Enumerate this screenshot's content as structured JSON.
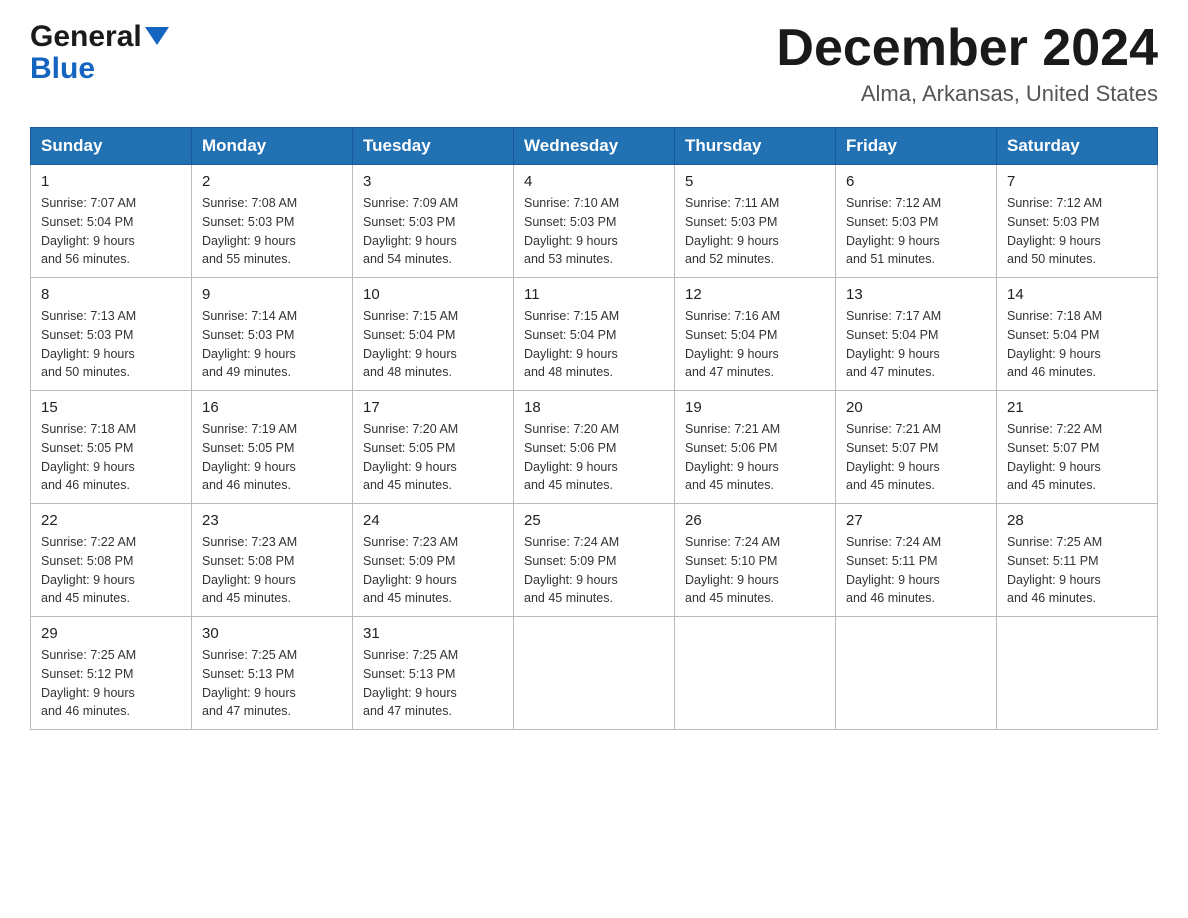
{
  "header": {
    "logo_general": "General",
    "logo_blue": "Blue",
    "month_year": "December 2024",
    "location": "Alma, Arkansas, United States"
  },
  "days_of_week": [
    "Sunday",
    "Monday",
    "Tuesday",
    "Wednesday",
    "Thursday",
    "Friday",
    "Saturday"
  ],
  "weeks": [
    [
      {
        "day": "1",
        "sunrise": "7:07 AM",
        "sunset": "5:04 PM",
        "daylight": "9 hours and 56 minutes."
      },
      {
        "day": "2",
        "sunrise": "7:08 AM",
        "sunset": "5:03 PM",
        "daylight": "9 hours and 55 minutes."
      },
      {
        "day": "3",
        "sunrise": "7:09 AM",
        "sunset": "5:03 PM",
        "daylight": "9 hours and 54 minutes."
      },
      {
        "day": "4",
        "sunrise": "7:10 AM",
        "sunset": "5:03 PM",
        "daylight": "9 hours and 53 minutes."
      },
      {
        "day": "5",
        "sunrise": "7:11 AM",
        "sunset": "5:03 PM",
        "daylight": "9 hours and 52 minutes."
      },
      {
        "day": "6",
        "sunrise": "7:12 AM",
        "sunset": "5:03 PM",
        "daylight": "9 hours and 51 minutes."
      },
      {
        "day": "7",
        "sunrise": "7:12 AM",
        "sunset": "5:03 PM",
        "daylight": "9 hours and 50 minutes."
      }
    ],
    [
      {
        "day": "8",
        "sunrise": "7:13 AM",
        "sunset": "5:03 PM",
        "daylight": "9 hours and 50 minutes."
      },
      {
        "day": "9",
        "sunrise": "7:14 AM",
        "sunset": "5:03 PM",
        "daylight": "9 hours and 49 minutes."
      },
      {
        "day": "10",
        "sunrise": "7:15 AM",
        "sunset": "5:04 PM",
        "daylight": "9 hours and 48 minutes."
      },
      {
        "day": "11",
        "sunrise": "7:15 AM",
        "sunset": "5:04 PM",
        "daylight": "9 hours and 48 minutes."
      },
      {
        "day": "12",
        "sunrise": "7:16 AM",
        "sunset": "5:04 PM",
        "daylight": "9 hours and 47 minutes."
      },
      {
        "day": "13",
        "sunrise": "7:17 AM",
        "sunset": "5:04 PM",
        "daylight": "9 hours and 47 minutes."
      },
      {
        "day": "14",
        "sunrise": "7:18 AM",
        "sunset": "5:04 PM",
        "daylight": "9 hours and 46 minutes."
      }
    ],
    [
      {
        "day": "15",
        "sunrise": "7:18 AM",
        "sunset": "5:05 PM",
        "daylight": "9 hours and 46 minutes."
      },
      {
        "day": "16",
        "sunrise": "7:19 AM",
        "sunset": "5:05 PM",
        "daylight": "9 hours and 46 minutes."
      },
      {
        "day": "17",
        "sunrise": "7:20 AM",
        "sunset": "5:05 PM",
        "daylight": "9 hours and 45 minutes."
      },
      {
        "day": "18",
        "sunrise": "7:20 AM",
        "sunset": "5:06 PM",
        "daylight": "9 hours and 45 minutes."
      },
      {
        "day": "19",
        "sunrise": "7:21 AM",
        "sunset": "5:06 PM",
        "daylight": "9 hours and 45 minutes."
      },
      {
        "day": "20",
        "sunrise": "7:21 AM",
        "sunset": "5:07 PM",
        "daylight": "9 hours and 45 minutes."
      },
      {
        "day": "21",
        "sunrise": "7:22 AM",
        "sunset": "5:07 PM",
        "daylight": "9 hours and 45 minutes."
      }
    ],
    [
      {
        "day": "22",
        "sunrise": "7:22 AM",
        "sunset": "5:08 PM",
        "daylight": "9 hours and 45 minutes."
      },
      {
        "day": "23",
        "sunrise": "7:23 AM",
        "sunset": "5:08 PM",
        "daylight": "9 hours and 45 minutes."
      },
      {
        "day": "24",
        "sunrise": "7:23 AM",
        "sunset": "5:09 PM",
        "daylight": "9 hours and 45 minutes."
      },
      {
        "day": "25",
        "sunrise": "7:24 AM",
        "sunset": "5:09 PM",
        "daylight": "9 hours and 45 minutes."
      },
      {
        "day": "26",
        "sunrise": "7:24 AM",
        "sunset": "5:10 PM",
        "daylight": "9 hours and 45 minutes."
      },
      {
        "day": "27",
        "sunrise": "7:24 AM",
        "sunset": "5:11 PM",
        "daylight": "9 hours and 46 minutes."
      },
      {
        "day": "28",
        "sunrise": "7:25 AM",
        "sunset": "5:11 PM",
        "daylight": "9 hours and 46 minutes."
      }
    ],
    [
      {
        "day": "29",
        "sunrise": "7:25 AM",
        "sunset": "5:12 PM",
        "daylight": "9 hours and 46 minutes."
      },
      {
        "day": "30",
        "sunrise": "7:25 AM",
        "sunset": "5:13 PM",
        "daylight": "9 hours and 47 minutes."
      },
      {
        "day": "31",
        "sunrise": "7:25 AM",
        "sunset": "5:13 PM",
        "daylight": "9 hours and 47 minutes."
      },
      null,
      null,
      null,
      null
    ]
  ],
  "labels": {
    "sunrise": "Sunrise:",
    "sunset": "Sunset:",
    "daylight": "Daylight:"
  }
}
